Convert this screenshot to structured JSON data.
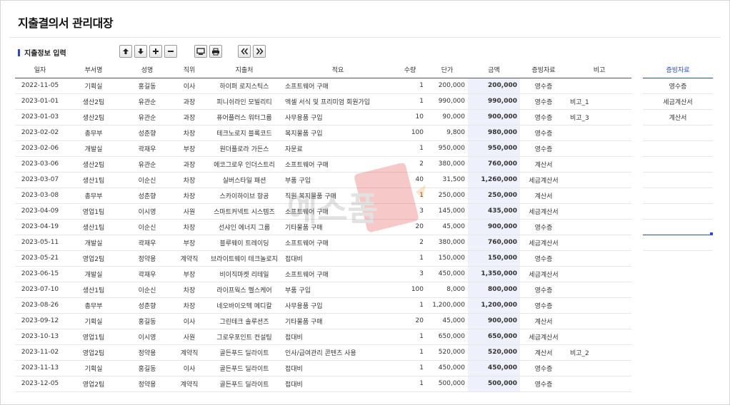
{
  "page": {
    "title": "지출결의서 관리대장"
  },
  "section": {
    "label": "지출정보 입력"
  },
  "toolbar": {
    "group1": [
      {
        "name": "move-up-button",
        "icon": "arrow-up-icon"
      },
      {
        "name": "move-down-button",
        "icon": "arrow-down-icon"
      },
      {
        "name": "add-row-button",
        "icon": "plus-icon"
      },
      {
        "name": "delete-row-button",
        "icon": "minus-icon"
      }
    ],
    "group2": [
      {
        "name": "view-button",
        "icon": "monitor-icon"
      },
      {
        "name": "print-button",
        "icon": "printer-icon"
      }
    ],
    "group3": [
      {
        "name": "prev-button",
        "icon": "double-chevron-left-icon"
      },
      {
        "name": "next-button",
        "icon": "double-chevron-right-icon"
      }
    ]
  },
  "table": {
    "headers": [
      "일자",
      "부서명",
      "성명",
      "직위",
      "지출처",
      "적요",
      "수량",
      "단가",
      "금액",
      "증빙자료",
      "비고"
    ],
    "rows": [
      [
        "2022-11-05",
        "기획실",
        "홍길동",
        "이사",
        "하이퍼 로지스틱스",
        "소프트웨어 구매",
        "1",
        "200,000",
        "200,000",
        "영수증",
        ""
      ],
      [
        "2023-01-01",
        "생산2팀",
        "유관순",
        "과장",
        "피니쉬라인 모빌리티",
        "엑셀 서식 및 프리미엄 회원가입",
        "1",
        "990,000",
        "990,000",
        "영수증",
        "비고_1"
      ],
      [
        "2023-01-03",
        "생산2팀",
        "유관순",
        "과장",
        "퓨어플러스 워터그룹",
        "사무용품 구입",
        "10",
        "90,000",
        "900,000",
        "영수증",
        "비고_3"
      ],
      [
        "2023-02-02",
        "총무부",
        "성춘향",
        "차장",
        "테크노로지 블록코드",
        "복지물품 구입",
        "100",
        "9,800",
        "980,000",
        "영수증",
        ""
      ],
      [
        "2023-02-06",
        "개발실",
        "곽재우",
        "부장",
        "원더플로라 가든스",
        "자문료",
        "1",
        "950,000",
        "950,000",
        "영수증",
        ""
      ],
      [
        "2023-03-06",
        "생산2팀",
        "유관순",
        "과장",
        "에코그로우 인더스트리",
        "소프트웨어 구매",
        "2",
        "380,000",
        "760,000",
        "계산서",
        ""
      ],
      [
        "2023-03-07",
        "생산1팀",
        "이순신",
        "차장",
        "실버스타일 패션",
        "부품 구입",
        "40",
        "31,500",
        "1,260,000",
        "세금계산서",
        ""
      ],
      [
        "2023-03-08",
        "총무부",
        "성춘향",
        "차장",
        "스카이하이브 항공",
        "직원 복지물품 구매",
        "1",
        "250,000",
        "250,000",
        "계산서",
        ""
      ],
      [
        "2023-04-09",
        "영업1팀",
        "이시영",
        "사원",
        "스마트커넥트 시스템즈",
        "소프트웨어 구매",
        "3",
        "145,000",
        "435,000",
        "세금계산서",
        ""
      ],
      [
        "2023-04-19",
        "생산1팀",
        "이순신",
        "차장",
        "선샤인 에너지 그룹",
        "기타물품 구매",
        "20",
        "45,000",
        "900,000",
        "영수증",
        ""
      ],
      [
        "2023-05-11",
        "개발실",
        "곽재우",
        "부장",
        "블루웨이 트레이딩",
        "소프트웨어 구매",
        "2",
        "380,000",
        "760,000",
        "세금계산서",
        ""
      ],
      [
        "2023-05-21",
        "영업2팀",
        "정약용",
        "계약직",
        "브라이트웨이 테크놀로지",
        "접대비",
        "1",
        "150,000",
        "150,000",
        "영수증",
        ""
      ],
      [
        "2023-06-15",
        "개발실",
        "곽재우",
        "부장",
        "비이직마켓 리테일",
        "소프트웨어 구매",
        "3",
        "450,000",
        "1,350,000",
        "세금계산서",
        ""
      ],
      [
        "2023-07-10",
        "생산1팀",
        "이순신",
        "차장",
        "라이프웍스 헬스케어",
        "부품 구입",
        "100",
        "8,000",
        "800,000",
        "영수증",
        ""
      ],
      [
        "2023-08-26",
        "총무부",
        "성춘향",
        "차장",
        "네오바이오텍 메디칼",
        "사무용품 구입",
        "1",
        "1,200,000",
        "1,200,000",
        "영수증",
        ""
      ],
      [
        "2023-09-12",
        "기획실",
        "홍길동",
        "이사",
        "그린테크 솔루션즈",
        "기타물품 구매",
        "20",
        "45,000",
        "900,000",
        "계산서",
        ""
      ],
      [
        "2023-10-13",
        "영업1팀",
        "이시영",
        "사원",
        "그로우포인트 컨설팅",
        "접대비",
        "1",
        "650,000",
        "650,000",
        "세금계산서",
        ""
      ],
      [
        "2023-11-02",
        "영업2팀",
        "정약용",
        "계약직",
        "골든푸드 딜라이트",
        "인사/급여관리 콘텐츠 사용",
        "1",
        "520,000",
        "520,000",
        "계산서",
        "비고_2"
      ],
      [
        "2023-11-13",
        "기획실",
        "홍길동",
        "이사",
        "골든푸드 딜라이트",
        "접대비",
        "1",
        "450,000",
        "450,000",
        "영수증",
        ""
      ],
      [
        "2023-12-05",
        "영업2팀",
        "정약용",
        "계약직",
        "골든푸드 딜라이트",
        "접대비",
        "1",
        "500,000",
        "500,000",
        "영수증",
        ""
      ]
    ]
  },
  "side": {
    "header": "증빙자료",
    "items": [
      "영수증",
      "세금계산서",
      "계산서",
      "",
      "",
      "",
      "",
      "",
      "",
      "",
      ""
    ]
  },
  "watermark": {
    "text": "예스폼"
  },
  "colors": {
    "accent": "#2d49c7",
    "amount_bg": "#eef1fb",
    "watermark": "#e0413d"
  }
}
